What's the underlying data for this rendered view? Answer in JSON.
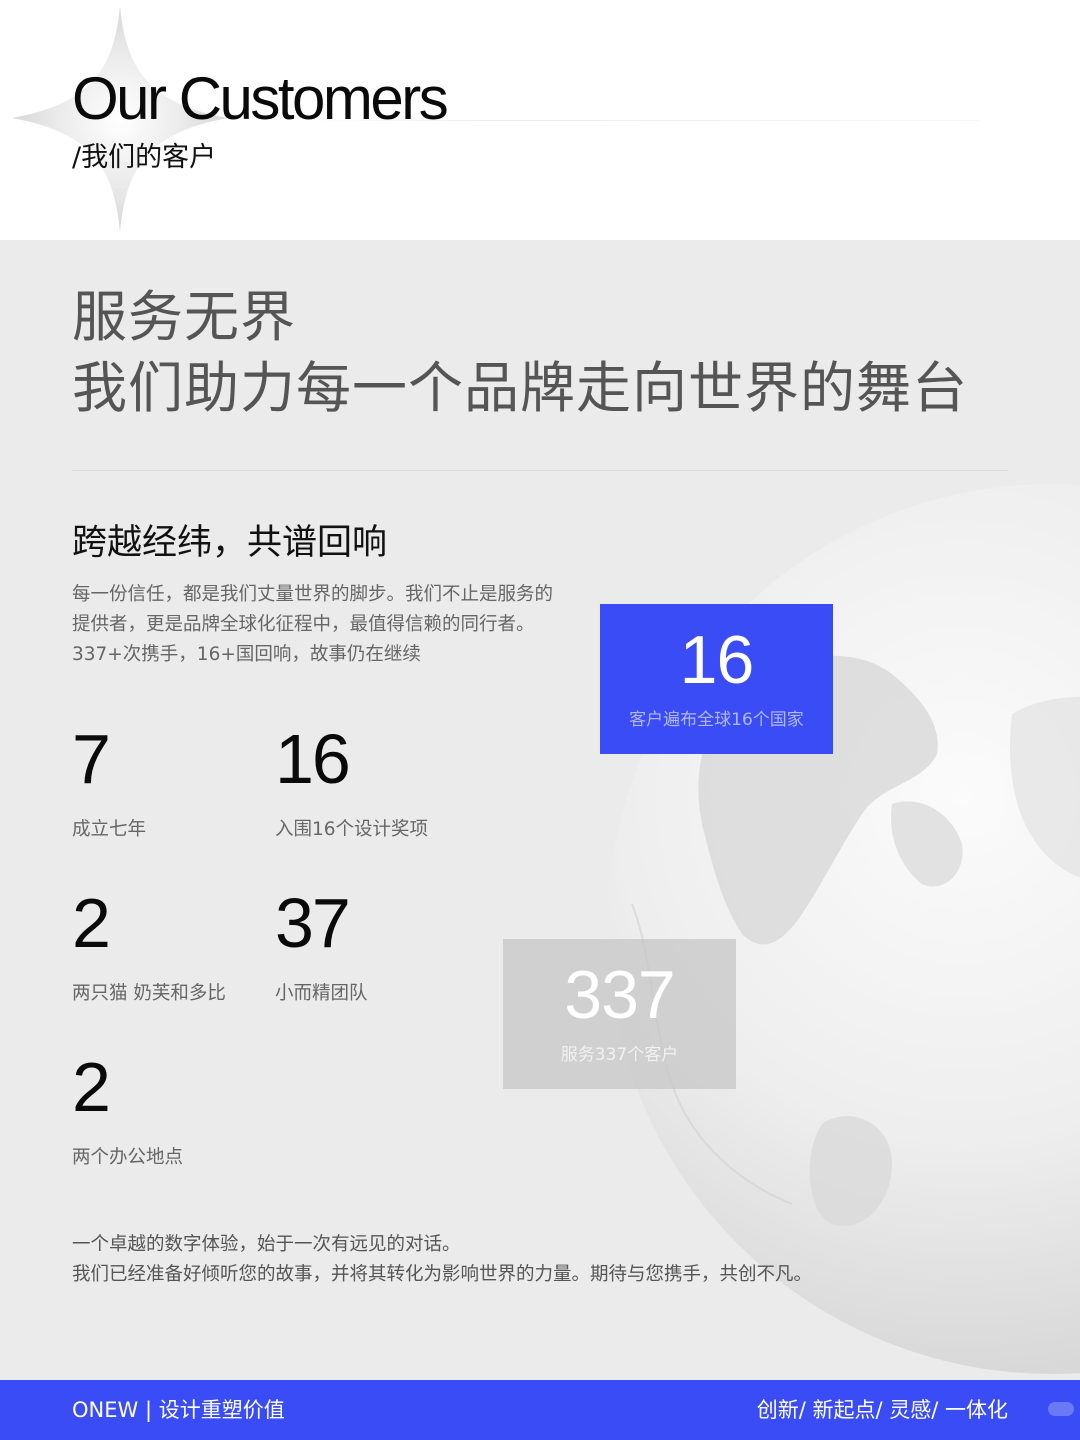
{
  "header": {
    "title": "Our Customers",
    "subtitle": "/我们的客户"
  },
  "intro": {
    "headline_line1": "服务无界",
    "headline_line2": "我们助力每一个品牌走向世界的舞台"
  },
  "section": {
    "title": "跨越经纬，共谱回响",
    "description": "每一份信任，都是我们丈量世界的脚步。我们不止是服务的提供者，更是品牌全球化征程中，最值得信赖的同行者。337+次携手，16+国回响，故事仍在继续"
  },
  "stats": [
    {
      "value": "7",
      "label": "成立七年"
    },
    {
      "value": "16",
      "label": "入围16个设计奖项"
    },
    {
      "value": "2",
      "label": "两只猫 奶芙和多比"
    },
    {
      "value": "37",
      "label": "小而精团队"
    },
    {
      "value": "2",
      "label": "两个办公地点"
    }
  ],
  "highlight_boxes": [
    {
      "value": "16",
      "label": "客户遍布全球16个国家",
      "color": "#3a4cf5"
    },
    {
      "value": "337",
      "label": "服务337个客户",
      "color": "#c8c8c8"
    }
  ],
  "closing": {
    "line1": "一个卓越的数字体验，始于一次有远见的对话。",
    "line2": "我们已经准备好倾听您的故事，并将其转化为影响世界的力量。期待与您携手，共创不凡。"
  },
  "footer": {
    "left": "ONEW | 设计重塑价值",
    "right": "创新/ 新起点/ 灵感/ 一体化"
  },
  "colors": {
    "accent": "#3a4cf5",
    "section_background": "#ebebeb"
  }
}
